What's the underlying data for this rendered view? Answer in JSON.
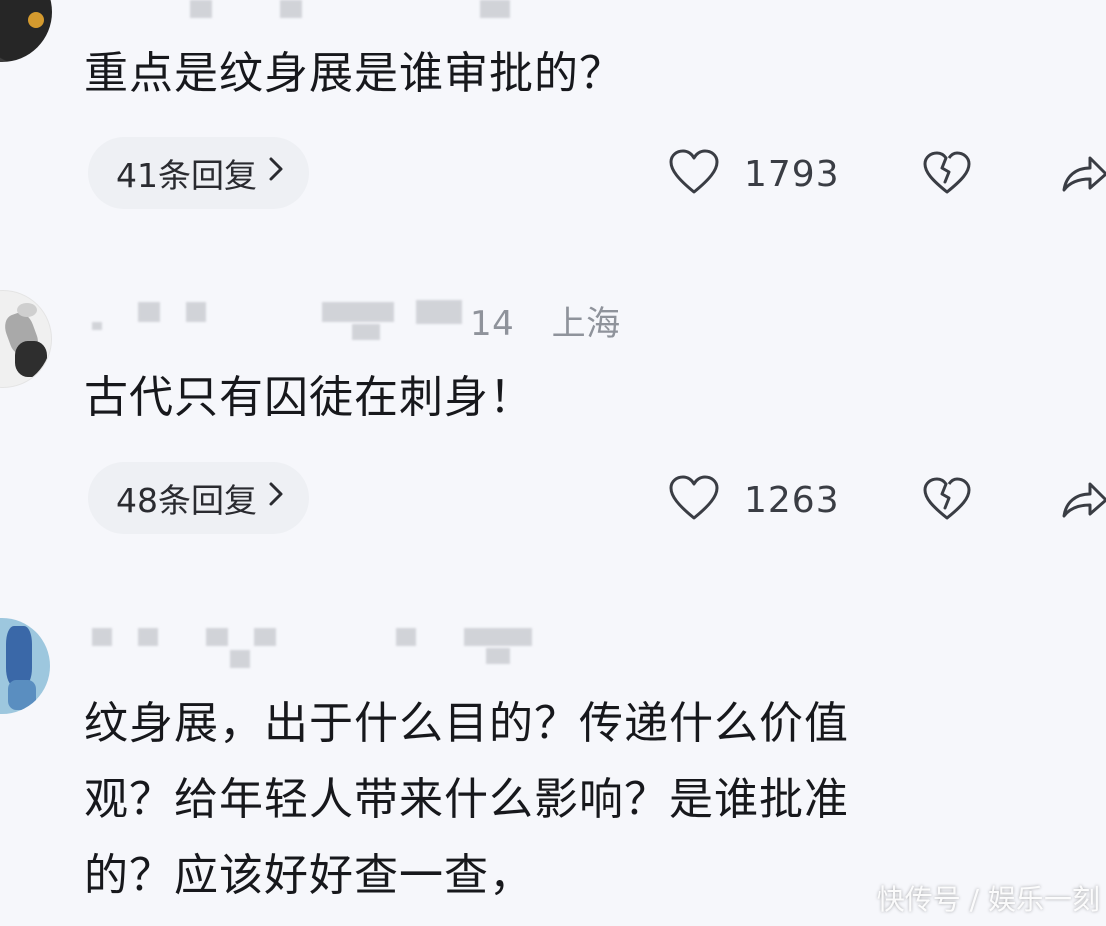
{
  "comments": [
    {
      "text": "重点是纹身展是谁审批的？",
      "reply_label": "41条回复",
      "like_count": "1793"
    },
    {
      "meta_suffix": "14",
      "location": "上海",
      "text": "古代只有囚徒在刺身！",
      "reply_label": "48条回复",
      "like_count": "1263"
    },
    {
      "text_lines": [
        "纹身展，出于什么目的？传递什么价值",
        "观？给年轻人带来什么影响？是谁批准",
        "的？应该好好查一查，"
      ]
    }
  ],
  "icons": {
    "chevron": "chevron-right-icon",
    "like": "heart-icon",
    "dislike": "broken-heart-icon",
    "share": "share-icon"
  },
  "watermark": "快传号 / 娱乐一刻"
}
